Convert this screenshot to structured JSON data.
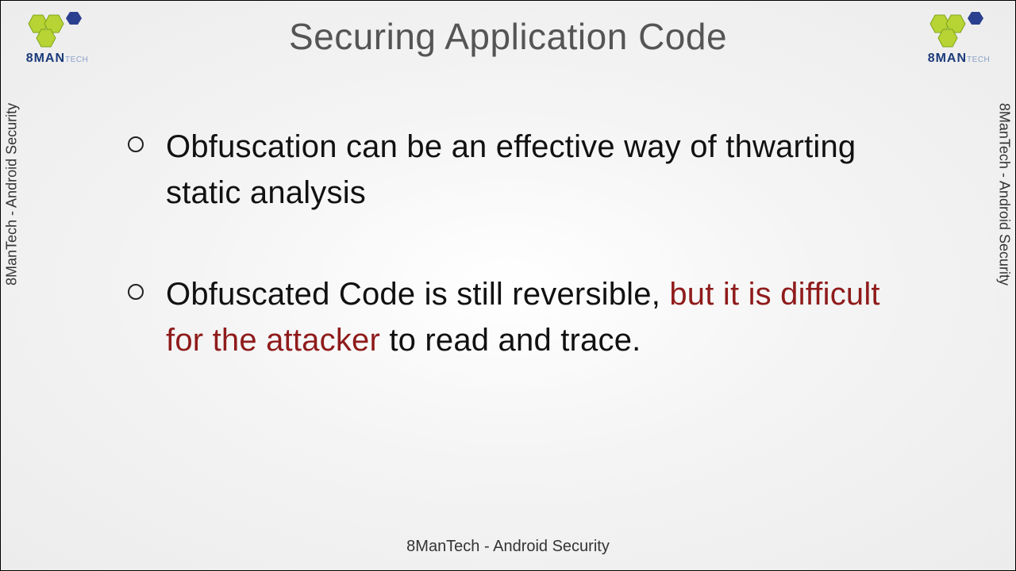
{
  "brand": {
    "name_html": "8MAN",
    "tech": "TECH"
  },
  "title": "Securing Application Code",
  "side_label": "8ManTech - Android Security",
  "footer": "8ManTech - Android Security",
  "bullets": [
    {
      "parts": [
        {
          "text": "Obfuscation can be an effective way of thwarting static analysis",
          "emph": false
        }
      ]
    },
    {
      "parts": [
        {
          "text": "Obfuscated Code is still reversible, ",
          "emph": false
        },
        {
          "text": "but it is difficult for the attacker",
          "emph": true
        },
        {
          "text": " to read and trace.",
          "emph": false
        }
      ]
    }
  ]
}
